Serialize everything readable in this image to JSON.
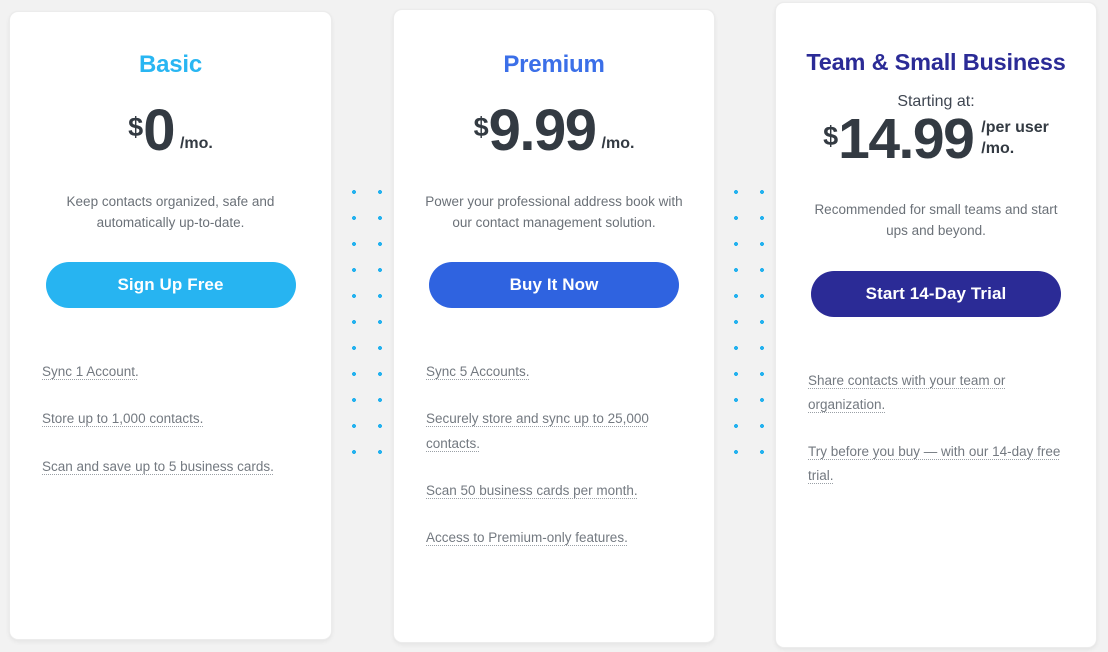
{
  "page": {
    "background_color": "#f2f2f2",
    "divider_dot_color": "#24b2ef"
  },
  "plans": [
    {
      "id": "basic",
      "title": "Basic",
      "title_color": "#29b6f2",
      "starting_at": "",
      "currency": "$",
      "amount": "0",
      "per_line_1": "/mo.",
      "per_line_2": "",
      "description": "Keep contacts organized, safe and automatically up-to-date.",
      "cta_label": "Sign Up Free",
      "cta_color": "#27b4f1",
      "features": [
        "Sync 1 Account.",
        "Store up to 1,000 contacts.",
        "Scan and save up to 5 business cards."
      ]
    },
    {
      "id": "premium",
      "title": "Premium",
      "title_color": "#3b6fe8",
      "starting_at": "",
      "currency": "$",
      "amount": "9.99",
      "per_line_1": "/mo.",
      "per_line_2": "",
      "description": "Power your professional address book with our contact management solution.",
      "cta_label": "Buy It Now",
      "cta_color": "#2f63e0",
      "features": [
        "Sync 5 Accounts.",
        "Securely store and sync up to 25,000 contacts.",
        "Scan 50 business cards per month.",
        "Access to Premium-only features."
      ]
    },
    {
      "id": "team",
      "title": "Team & Small Business",
      "title_color": "#2b2b96",
      "starting_at": "Starting at:",
      "currency": "$",
      "amount": "14.99",
      "per_line_1": "/per user",
      "per_line_2": "/mo.",
      "description": "Recommended for small teams and start ups and beyond.",
      "cta_label": "Start 14-Day Trial",
      "cta_color": "#2b2b96",
      "features": [
        "Share contacts with your team or organization.",
        "Try before you buy — with our 14-day free trial."
      ]
    }
  ]
}
